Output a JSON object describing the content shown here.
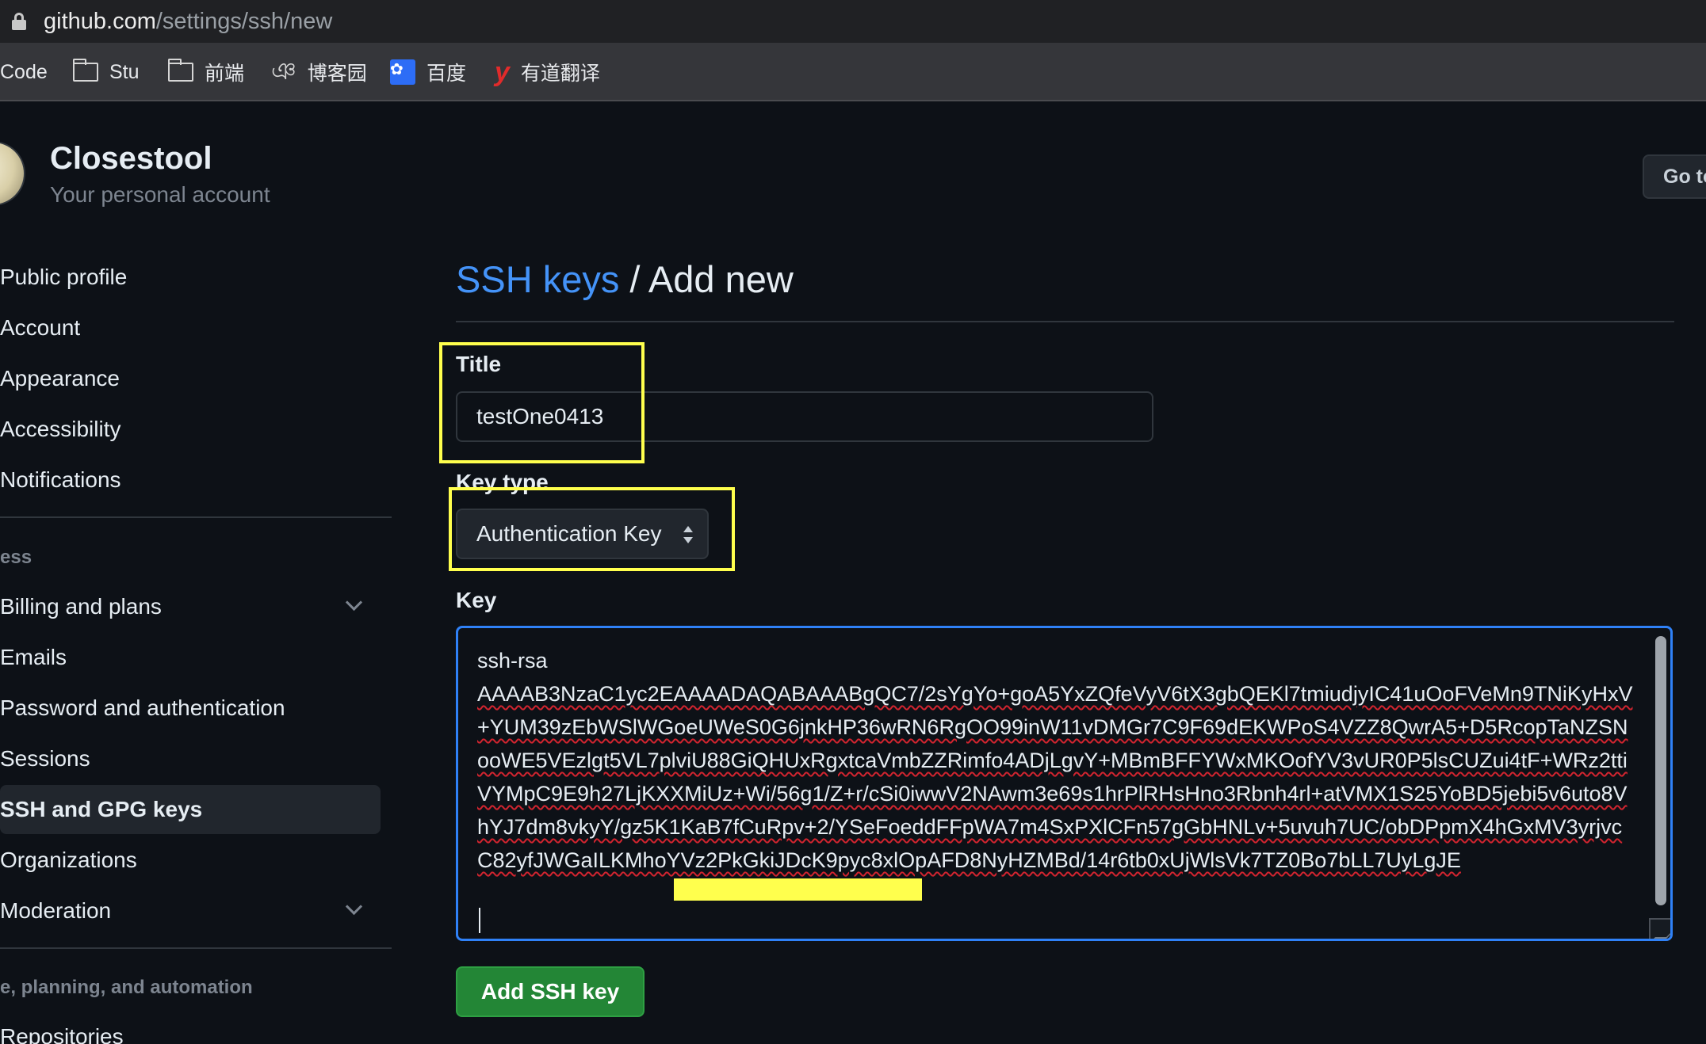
{
  "browser": {
    "url_host": "github.com",
    "url_path": "/settings/ssh/new",
    "bookmarks": [
      {
        "label": "Code",
        "icon": "none"
      },
      {
        "label": "Stu",
        "icon": "folder-icon"
      },
      {
        "label": "前端",
        "icon": "folder-icon"
      },
      {
        "label": "博客园",
        "icon": "cnblogs-icon"
      },
      {
        "label": "百度",
        "icon": "baidu-icon"
      },
      {
        "label": "有道翻译",
        "icon": "youdao-icon"
      }
    ]
  },
  "account": {
    "name": "Closestool",
    "subtitle": "Your personal account",
    "goto_button": "Go to"
  },
  "sidebar": {
    "items": [
      {
        "label": "Public profile"
      },
      {
        "label": "Account"
      },
      {
        "label": "Appearance"
      },
      {
        "label": "Accessibility"
      },
      {
        "label": "Notifications"
      }
    ],
    "group_access": "ess",
    "access_items": [
      {
        "label": "Billing and plans",
        "expandable": true
      },
      {
        "label": "Emails"
      },
      {
        "label": "Password and authentication"
      },
      {
        "label": "Sessions"
      },
      {
        "label": "SSH and GPG keys",
        "active": true
      },
      {
        "label": "Organizations"
      },
      {
        "label": "Moderation",
        "expandable": true
      }
    ],
    "group_code": "e, planning, and automation",
    "code_items": [
      {
        "label": "Repositories"
      }
    ]
  },
  "main": {
    "breadcrumb_link": "SSH keys",
    "breadcrumb_rest": " / Add new",
    "title_label": "Title",
    "title_value": "testOne0413",
    "key_type_label": "Key type",
    "key_type_value": "Authentication Key",
    "key_label": "Key",
    "key_first_line": "ssh-rsa",
    "key_body": "AAAAB3NzaC1yc2EAAAADAQABAAABgQC7/2sYgYo+goA5YxZQfeVyV6tX3gbQEKl7tmiudjyIC41uOoFVeMn9TNiKyHxV+YUM39zEbWSlWGoeUWeS0G6jnkHP36wRN6RgOO99inW11vDMGr7C9F69dEKWPoS4VZZ8QwrA5+D5RcopTaNZSNooWE5VEzlgt5VL7plviU88GiQHUxRgxtcaVmbZZRimfo4ADjLgvY+MBmBFFYWxMKOofYV3vUR0P5lsCUZui4tF+WRz2ttiVYMpC9E9h27LjKXXMiUz+Wi/56g1/Z+r/cSi0iwwV2NAwm3e69s1hrPlRHsHno3Rbnh4rl+atVMX1S25YoBD5jebi5v6uto8VhYJ7dm8vkyY/gz5K1KaB7fCuRpv+2/YSeFoeddFFpWA7m4SxPXlCFn57gGbHNLv+5uvuh7UC/obDPpmX4hGxMV3yrjvcC82yfJWGaILKMhoYVz2PkGkiJDcK9pyc8xlOpAFD8NyHZMBd/14r6tb0xUjWlsVk7TZ0Bo7bLL7UyLgJE",
    "submit_label": "Add SSH key"
  },
  "colors": {
    "link": "#4493f8",
    "primary_button": "#238636",
    "focus_border": "#2f81f7",
    "annotation": "#ffff4d"
  }
}
